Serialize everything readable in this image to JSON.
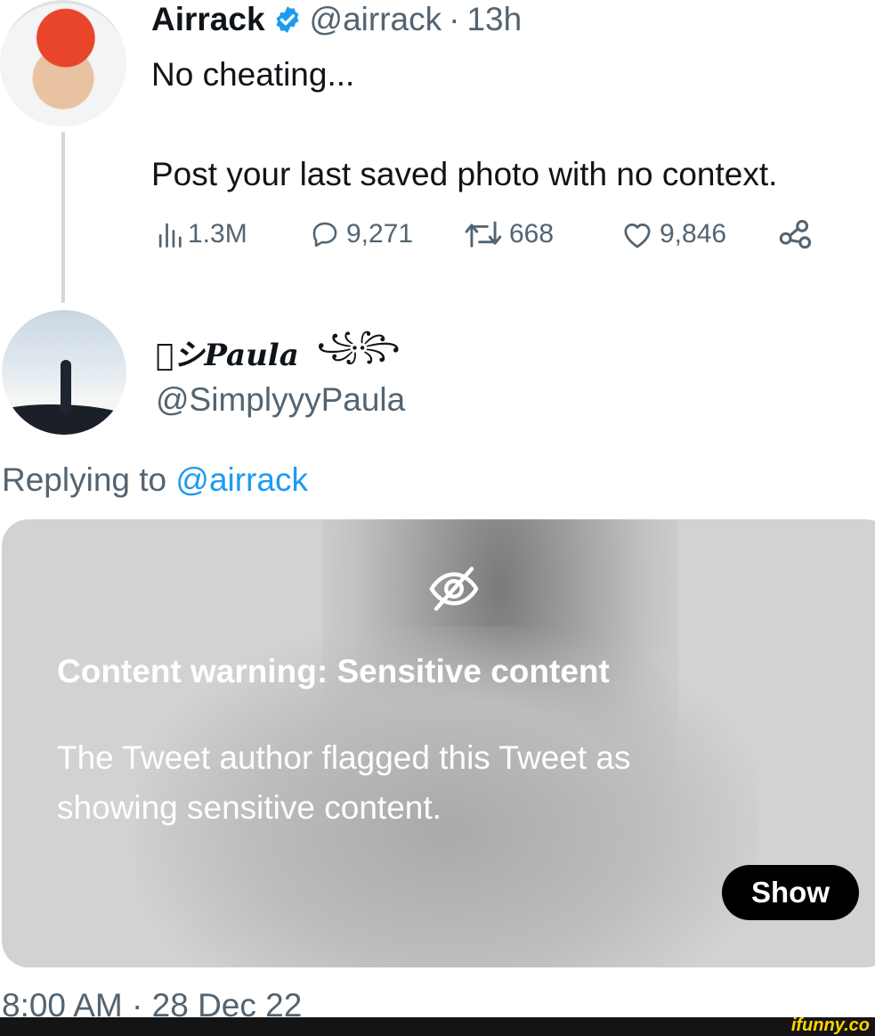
{
  "tweet": {
    "author_name": "Airrack",
    "handle": "@airrack",
    "separator": "·",
    "time": "13h",
    "text": "No cheating...\n\nPost your last saved photo with no context.",
    "stats": {
      "views": "1.3M",
      "replies": "9,271",
      "retweets": "668",
      "likes": "9,846"
    }
  },
  "reply": {
    "display_name": "シPaula",
    "name_decoration": "꧁꧂",
    "handle": "@SimplyyyPaula",
    "replying_prefix": "Replying to",
    "replying_to": "@airrack",
    "warning": {
      "title": "Content warning: Sensitive content",
      "body": "The Tweet author flagged this Tweet as showing sensitive content.",
      "show_label": "Show"
    },
    "timestamp": "8:00 AM · 28 Dec 22"
  },
  "watermark": "ifunny.co",
  "colors": {
    "accent": "#1d9bf0",
    "verified": "#1d9bf0",
    "secondary_text": "#536471"
  },
  "icons": {
    "verified": "verified-badge-icon",
    "views": "views-bar-chart-icon",
    "reply": "reply-bubble-icon",
    "retweet": "retweet-icon",
    "like": "heart-icon",
    "share": "share-icon",
    "sensitive": "eye-off-icon"
  }
}
